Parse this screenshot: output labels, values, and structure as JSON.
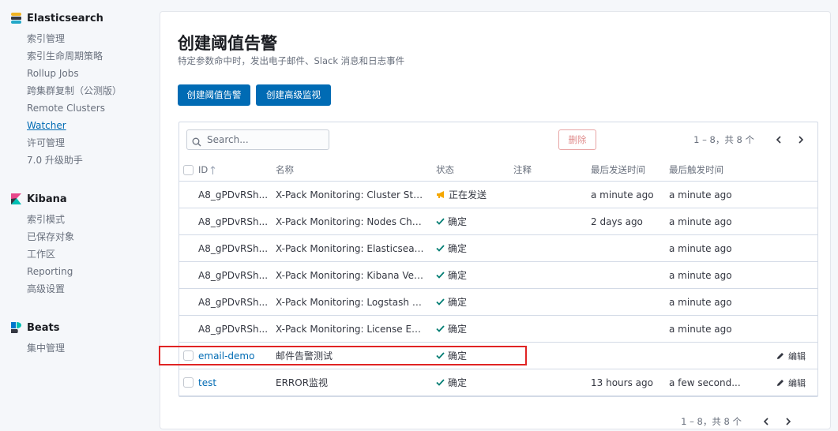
{
  "sidebar": {
    "elasticsearch": {
      "title": "Elasticsearch",
      "items": [
        "索引管理",
        "索引生命周期策略",
        "Rollup Jobs",
        "跨集群复制（公测版）",
        "Remote Clusters",
        "Watcher",
        "许可管理",
        "7.0 升级助手"
      ],
      "active": "Watcher"
    },
    "kibana": {
      "title": "Kibana",
      "items": [
        "索引模式",
        "已保存对象",
        "工作区",
        "Reporting",
        "高级设置"
      ]
    },
    "beats": {
      "title": "Beats",
      "items": [
        "集中管理"
      ]
    }
  },
  "page": {
    "title": "创建阈值告警",
    "subtitle": "特定参数命中时，发出电子邮件、Slack 消息和日志事件",
    "btn_threshold": "创建阈值告警",
    "btn_advanced": "创建高级监视"
  },
  "table": {
    "search_placeholder": "Search...",
    "delete_label": "删除",
    "pagination": "1 – 8，共 8 个",
    "headers": {
      "id": "ID",
      "name": "名称",
      "state": "状态",
      "comment": "注释",
      "last_sent": "最后发送时间",
      "last_fired": "最后触发时间"
    },
    "rows": [
      {
        "id": "A8_gPDvRSh...",
        "name": "X-Pack Monitoring: Cluster Stat...",
        "state": "正在发送",
        "state_type": "firing",
        "comment": "",
        "last_sent": "a minute ago",
        "last_fired": "a minute ago",
        "edit": ""
      },
      {
        "id": "A8_gPDvRSh...",
        "name": "X-Pack Monitoring: Nodes Chan...",
        "state": "确定",
        "state_type": "ok",
        "comment": "",
        "last_sent": "2 days ago",
        "last_fired": "a minute ago",
        "edit": ""
      },
      {
        "id": "A8_gPDvRSh...",
        "name": "X-Pack Monitoring: Elasticsearc...",
        "state": "确定",
        "state_type": "ok",
        "comment": "",
        "last_sent": "",
        "last_fired": "a minute ago",
        "edit": ""
      },
      {
        "id": "A8_gPDvRSh...",
        "name": "X-Pack Monitoring: Kibana Vers...",
        "state": "确定",
        "state_type": "ok",
        "comment": "",
        "last_sent": "",
        "last_fired": "a minute ago",
        "edit": ""
      },
      {
        "id": "A8_gPDvRSh...",
        "name": "X-Pack Monitoring: Logstash Ve...",
        "state": "确定",
        "state_type": "ok",
        "comment": "",
        "last_sent": "",
        "last_fired": "a minute ago",
        "edit": ""
      },
      {
        "id": "A8_gPDvRSh...",
        "name": "X-Pack Monitoring: License Expi...",
        "state": "确定",
        "state_type": "ok",
        "comment": "",
        "last_sent": "",
        "last_fired": "a minute ago",
        "edit": ""
      },
      {
        "id": "email-demo",
        "name": "邮件告警测试",
        "state": "确定",
        "state_type": "ok",
        "comment": "",
        "last_sent": "",
        "last_fired": "",
        "edit": "编辑",
        "checkbox": true,
        "link": true
      },
      {
        "id": "test",
        "name": "ERROR监视",
        "state": "确定",
        "state_type": "ok",
        "comment": "",
        "last_sent": "13 hours ago",
        "last_fired": "a few second...",
        "edit": "编辑",
        "checkbox": true,
        "link": true
      }
    ]
  },
  "colors": {
    "primary": "#006bb4",
    "ok": "#017d73",
    "firing": "#f5a700",
    "highlight": "#e02424"
  },
  "icons": [
    "elasticsearch-logo-icon",
    "kibana-logo-icon",
    "beats-logo-icon",
    "search-icon",
    "sort-up-icon",
    "check-icon",
    "megaphone-icon",
    "pencil-icon",
    "chevron-left-icon",
    "chevron-right-icon"
  ]
}
